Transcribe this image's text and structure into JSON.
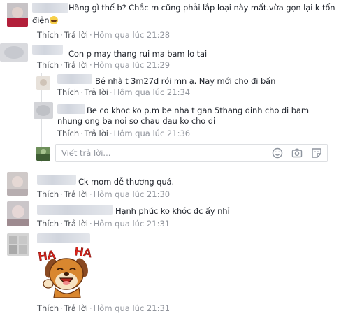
{
  "actions": {
    "like": "Thích",
    "reply": "Trả lời",
    "separator": "·"
  },
  "comments": [
    {
      "text_line1": "Hãng gì thế b? Chắc m cũng phải lắp loại này mất.vừa gọn lại k tốn",
      "text_line2": "điện",
      "timestamp": "Hôm qua lúc 21:28"
    },
    {
      "text": "Con p may thang rui ma bam lo tai",
      "timestamp": "Hôm qua lúc 21:29",
      "replies": [
        {
          "text": "Bé nhà t 3m27d rồi mn ạ. Nay mới cho đi bấn",
          "timestamp": "Hôm qua lúc 21:34"
        },
        {
          "text_line1": "Be co khoc ko p.m be nha t gan 5thang dinh cho di bam",
          "text_line2": "nhung ong ba noi so chau dau ko cho di",
          "timestamp": "Hôm qua lúc 21:36"
        }
      ]
    },
    {
      "text": "Ck mom dễ thương quá.",
      "timestamp": "Hôm qua lúc 21:30"
    },
    {
      "text": "Hạnh phúc ko khóc đc ấy nhỉ",
      "timestamp": "Hôm qua lúc 21:31"
    },
    {
      "sticker_text_left": "HA",
      "sticker_text_right": "HA",
      "timestamp": "Hôm qua lúc 21:31"
    }
  ],
  "reply_box": {
    "placeholder": "Viết trả lời...",
    "icons": [
      "emoji-icon",
      "camera-icon",
      "sticker-icon"
    ]
  },
  "colors": {
    "link": "#4b4f56",
    "timestamp": "#90949c",
    "text": "#1d2129",
    "sticker_red": "#e2231a"
  }
}
